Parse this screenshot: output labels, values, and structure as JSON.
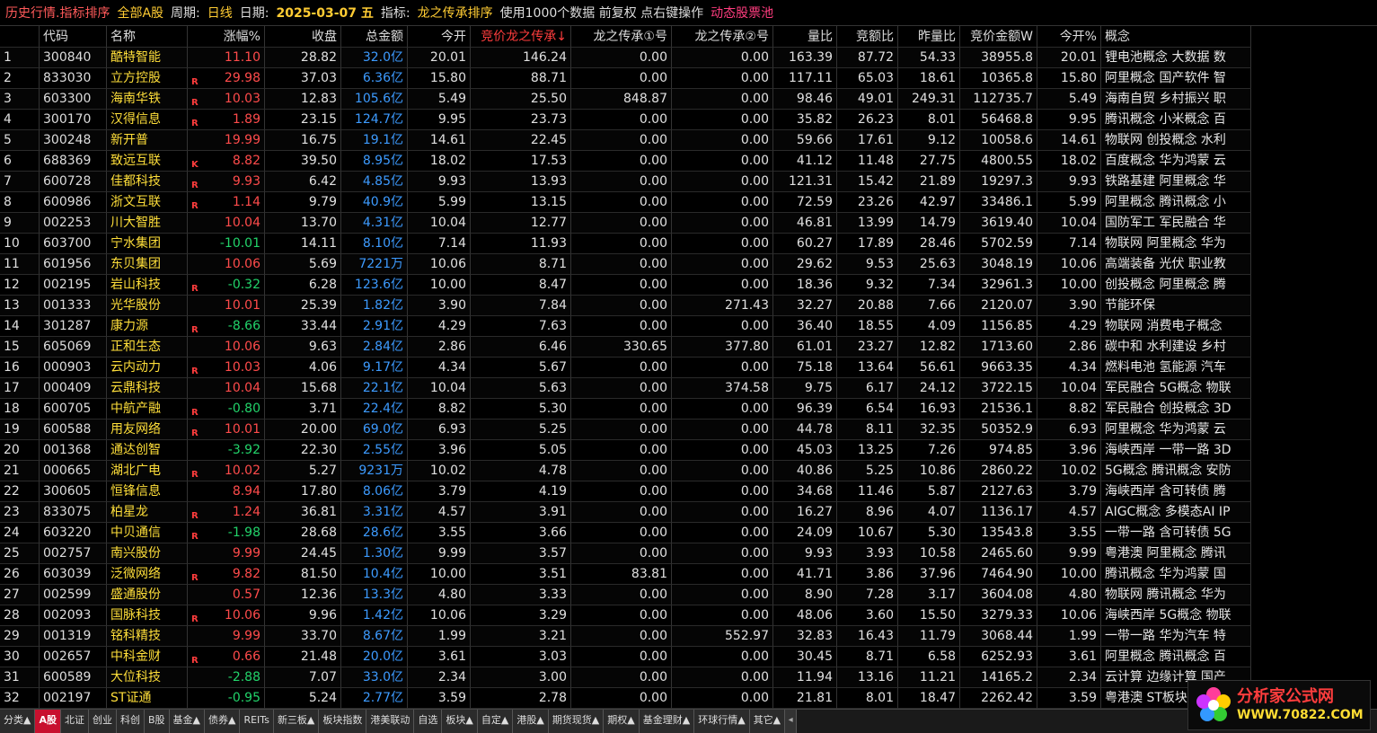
{
  "titlebar": {
    "part1": "历史行情.指标排序",
    "part2": "全部A股",
    "period_label": "周期:",
    "period_value": "日线",
    "date_label": "日期:",
    "date_value": "2025-03-07 五",
    "indicator_label": "指标:",
    "indicator_value": "龙之传承排序",
    "note": "使用1000个数据 前复权 点右键操作",
    "pool": "动态股票池"
  },
  "headers": [
    "",
    "代码",
    "名称",
    "涨幅%",
    "收盘",
    "总金额",
    "今开",
    "竞价龙之传承↓",
    "龙之传承①号",
    "龙之传承②号",
    "量比",
    "竞额比",
    "昨量比",
    "竞价金额W",
    "今开%",
    "概念"
  ],
  "rows": [
    {
      "no": "1",
      "code": "300840",
      "name": "酷特智能",
      "flag": "",
      "chg": "11.10",
      "dir": "up",
      "close": "28.82",
      "amt": "32.0亿",
      "open": "20.01",
      "jj": "146.24",
      "l1": "0.00",
      "l2": "0.00",
      "vr": "163.39",
      "jeb": "87.72",
      "zlb": "54.33",
      "jjje": "38955.8",
      "openpct": "20.01",
      "concept": "锂电池概念 大数据 数"
    },
    {
      "no": "2",
      "code": "833030",
      "name": "立方控股",
      "flag": "R",
      "chg": "29.98",
      "dir": "up",
      "close": "37.03",
      "amt": "6.36亿",
      "open": "15.80",
      "jj": "88.71",
      "l1": "0.00",
      "l2": "0.00",
      "vr": "117.11",
      "jeb": "65.03",
      "zlb": "18.61",
      "jjje": "10365.8",
      "openpct": "15.80",
      "concept": "阿里概念 国产软件 智"
    },
    {
      "no": "3",
      "code": "603300",
      "name": "海南华铁",
      "flag": "R",
      "chg": "10.03",
      "dir": "up",
      "close": "12.83",
      "amt": "105.6亿",
      "open": "5.49",
      "jj": "25.50",
      "l1": "848.87",
      "l2": "0.00",
      "vr": "98.46",
      "jeb": "49.01",
      "zlb": "249.31",
      "jjje": "112735.7",
      "openpct": "5.49",
      "concept": "海南自贸 乡村振兴 职"
    },
    {
      "no": "4",
      "code": "300170",
      "name": "汉得信息",
      "flag": "R",
      "chg": "1.89",
      "dir": "up",
      "close": "23.15",
      "amt": "124.7亿",
      "open": "9.95",
      "jj": "23.73",
      "l1": "0.00",
      "l2": "0.00",
      "vr": "35.82",
      "jeb": "26.23",
      "zlb": "8.01",
      "jjje": "56468.8",
      "openpct": "9.95",
      "concept": "腾讯概念 小米概念 百"
    },
    {
      "no": "5",
      "code": "300248",
      "name": "新开普",
      "flag": "",
      "chg": "19.99",
      "dir": "up",
      "close": "16.75",
      "amt": "19.1亿",
      "open": "14.61",
      "jj": "22.45",
      "l1": "0.00",
      "l2": "0.00",
      "vr": "59.66",
      "jeb": "17.61",
      "zlb": "9.12",
      "jjje": "10058.6",
      "openpct": "14.61",
      "concept": "物联网 创投概念 水利"
    },
    {
      "no": "6",
      "code": "688369",
      "name": "致远互联",
      "flag": "K",
      "chg": "8.82",
      "dir": "up",
      "close": "39.50",
      "amt": "8.95亿",
      "open": "18.02",
      "jj": "17.53",
      "l1": "0.00",
      "l2": "0.00",
      "vr": "41.12",
      "jeb": "11.48",
      "zlb": "27.75",
      "jjje": "4800.55",
      "openpct": "18.02",
      "concept": "百度概念 华为鸿蒙 云"
    },
    {
      "no": "7",
      "code": "600728",
      "name": "佳都科技",
      "flag": "R",
      "chg": "9.93",
      "dir": "up",
      "close": "6.42",
      "amt": "4.85亿",
      "open": "9.93",
      "jj": "13.93",
      "l1": "0.00",
      "l2": "0.00",
      "vr": "121.31",
      "jeb": "15.42",
      "zlb": "21.89",
      "jjje": "19297.3",
      "openpct": "9.93",
      "concept": "铁路基建 阿里概念 华"
    },
    {
      "no": "8",
      "code": "600986",
      "name": "浙文互联",
      "flag": "R",
      "chg": "1.14",
      "dir": "up",
      "close": "9.79",
      "amt": "40.9亿",
      "open": "5.99",
      "jj": "13.15",
      "l1": "0.00",
      "l2": "0.00",
      "vr": "72.59",
      "jeb": "23.26",
      "zlb": "42.97",
      "jjje": "33486.1",
      "openpct": "5.99",
      "concept": "阿里概念 腾讯概念 小"
    },
    {
      "no": "9",
      "code": "002253",
      "name": "川大智胜",
      "flag": "",
      "chg": "10.04",
      "dir": "up",
      "close": "13.70",
      "amt": "4.31亿",
      "open": "10.04",
      "jj": "12.77",
      "l1": "0.00",
      "l2": "0.00",
      "vr": "46.81",
      "jeb": "13.99",
      "zlb": "14.79",
      "jjje": "3619.40",
      "openpct": "10.04",
      "concept": "国防军工 军民融合 华"
    },
    {
      "no": "10",
      "code": "603700",
      "name": "宁水集团",
      "flag": "",
      "chg": "-10.01",
      "dir": "down",
      "close": "14.11",
      "amt": "8.10亿",
      "open": "7.14",
      "jj": "11.93",
      "l1": "0.00",
      "l2": "0.00",
      "vr": "60.27",
      "jeb": "17.89",
      "zlb": "28.46",
      "jjje": "5702.59",
      "openpct": "7.14",
      "concept": "物联网 阿里概念 华为"
    },
    {
      "no": "11",
      "code": "601956",
      "name": "东贝集团",
      "flag": "",
      "chg": "10.06",
      "dir": "up",
      "close": "5.69",
      "amt": "7221万",
      "open": "10.06",
      "jj": "8.71",
      "l1": "0.00",
      "l2": "0.00",
      "vr": "29.62",
      "jeb": "9.53",
      "zlb": "25.63",
      "jjje": "3048.19",
      "openpct": "10.06",
      "concept": "高端装备 光伏 职业教"
    },
    {
      "no": "12",
      "code": "002195",
      "name": "岩山科技",
      "flag": "R",
      "chg": "-0.32",
      "dir": "down",
      "close": "6.28",
      "amt": "123.6亿",
      "open": "10.00",
      "jj": "8.47",
      "l1": "0.00",
      "l2": "0.00",
      "vr": "18.36",
      "jeb": "9.32",
      "zlb": "7.34",
      "jjje": "32961.3",
      "openpct": "10.00",
      "concept": "创投概念 阿里概念 腾"
    },
    {
      "no": "13",
      "code": "001333",
      "name": "光华股份",
      "flag": "",
      "chg": "10.01",
      "dir": "up",
      "close": "25.39",
      "amt": "1.82亿",
      "open": "3.90",
      "jj": "7.84",
      "l1": "0.00",
      "l2": "271.43",
      "vr": "32.27",
      "jeb": "20.88",
      "zlb": "7.66",
      "jjje": "2120.07",
      "openpct": "3.90",
      "concept": "节能环保"
    },
    {
      "no": "14",
      "code": "301287",
      "name": "康力源",
      "flag": "R",
      "chg": "-8.66",
      "dir": "down",
      "close": "33.44",
      "amt": "2.91亿",
      "open": "4.29",
      "jj": "7.63",
      "l1": "0.00",
      "l2": "0.00",
      "vr": "36.40",
      "jeb": "18.55",
      "zlb": "4.09",
      "jjje": "1156.85",
      "openpct": "4.29",
      "concept": "物联网 消费电子概念"
    },
    {
      "no": "15",
      "code": "605069",
      "name": "正和生态",
      "flag": "",
      "chg": "10.06",
      "dir": "up",
      "close": "9.63",
      "amt": "2.84亿",
      "open": "2.86",
      "jj": "6.46",
      "l1": "330.65",
      "l2": "377.80",
      "vr": "61.01",
      "jeb": "23.27",
      "zlb": "12.82",
      "jjje": "1713.60",
      "openpct": "2.86",
      "concept": "碳中和 水利建设 乡村"
    },
    {
      "no": "16",
      "code": "000903",
      "name": "云内动力",
      "flag": "R",
      "chg": "10.03",
      "dir": "up",
      "close": "4.06",
      "amt": "9.17亿",
      "open": "4.34",
      "jj": "5.67",
      "l1": "0.00",
      "l2": "0.00",
      "vr": "75.18",
      "jeb": "13.64",
      "zlb": "56.61",
      "jjje": "9663.35",
      "openpct": "4.34",
      "concept": "燃料电池 氢能源 汽车"
    },
    {
      "no": "17",
      "code": "000409",
      "name": "云鼎科技",
      "flag": "",
      "chg": "10.04",
      "dir": "up",
      "close": "15.68",
      "amt": "22.1亿",
      "open": "10.04",
      "jj": "5.63",
      "l1": "0.00",
      "l2": "374.58",
      "vr": "9.75",
      "jeb": "6.17",
      "zlb": "24.12",
      "jjje": "3722.15",
      "openpct": "10.04",
      "concept": "军民融合 5G概念 物联"
    },
    {
      "no": "18",
      "code": "600705",
      "name": "中航产融",
      "flag": "R",
      "chg": "-0.80",
      "dir": "down",
      "close": "3.71",
      "amt": "22.4亿",
      "open": "8.82",
      "jj": "5.30",
      "l1": "0.00",
      "l2": "0.00",
      "vr": "96.39",
      "jeb": "6.54",
      "zlb": "16.93",
      "jjje": "21536.1",
      "openpct": "8.82",
      "concept": "军民融合 创投概念 3D"
    },
    {
      "no": "19",
      "code": "600588",
      "name": "用友网络",
      "flag": "R",
      "chg": "10.01",
      "dir": "up",
      "close": "20.00",
      "amt": "69.0亿",
      "open": "6.93",
      "jj": "5.25",
      "l1": "0.00",
      "l2": "0.00",
      "vr": "44.78",
      "jeb": "8.11",
      "zlb": "32.35",
      "jjje": "50352.9",
      "openpct": "6.93",
      "concept": "阿里概念 华为鸿蒙 云"
    },
    {
      "no": "20",
      "code": "001368",
      "name": "通达创智",
      "flag": "",
      "chg": "-3.92",
      "dir": "down",
      "close": "22.30",
      "amt": "2.55亿",
      "open": "3.96",
      "jj": "5.05",
      "l1": "0.00",
      "l2": "0.00",
      "vr": "45.03",
      "jeb": "13.25",
      "zlb": "7.26",
      "jjje": "974.85",
      "openpct": "3.96",
      "concept": "海峡西岸 一带一路 3D"
    },
    {
      "no": "21",
      "code": "000665",
      "name": "湖北广电",
      "flag": "R",
      "chg": "10.02",
      "dir": "up",
      "close": "5.27",
      "amt": "9231万",
      "open": "10.02",
      "jj": "4.78",
      "l1": "0.00",
      "l2": "0.00",
      "vr": "40.86",
      "jeb": "5.25",
      "zlb": "10.86",
      "jjje": "2860.22",
      "openpct": "10.02",
      "concept": "5G概念 腾讯概念 安防"
    },
    {
      "no": "22",
      "code": "300605",
      "name": "恒锋信息",
      "flag": "",
      "chg": "8.94",
      "dir": "up",
      "close": "17.80",
      "amt": "8.06亿",
      "open": "3.79",
      "jj": "4.19",
      "l1": "0.00",
      "l2": "0.00",
      "vr": "34.68",
      "jeb": "11.46",
      "zlb": "5.87",
      "jjje": "2127.63",
      "openpct": "3.79",
      "concept": "海峡西岸 含可转债 腾"
    },
    {
      "no": "23",
      "code": "833075",
      "name": "柏星龙",
      "flag": "R",
      "chg": "1.24",
      "dir": "up",
      "close": "36.81",
      "amt": "3.31亿",
      "open": "4.57",
      "jj": "3.91",
      "l1": "0.00",
      "l2": "0.00",
      "vr": "16.27",
      "jeb": "8.96",
      "zlb": "4.07",
      "jjje": "1136.17",
      "openpct": "4.57",
      "concept": "AIGC概念 多模态AI IP"
    },
    {
      "no": "24",
      "code": "603220",
      "name": "中贝通信",
      "flag": "R",
      "chg": "-1.98",
      "dir": "down",
      "close": "28.68",
      "amt": "28.6亿",
      "open": "3.55",
      "jj": "3.66",
      "l1": "0.00",
      "l2": "0.00",
      "vr": "24.09",
      "jeb": "10.67",
      "zlb": "5.30",
      "jjje": "13543.8",
      "openpct": "3.55",
      "concept": "一带一路 含可转债 5G"
    },
    {
      "no": "25",
      "code": "002757",
      "name": "南兴股份",
      "flag": "",
      "chg": "9.99",
      "dir": "up",
      "close": "24.45",
      "amt": "1.30亿",
      "open": "9.99",
      "jj": "3.57",
      "l1": "0.00",
      "l2": "0.00",
      "vr": "9.93",
      "jeb": "3.93",
      "zlb": "10.58",
      "jjje": "2465.60",
      "openpct": "9.99",
      "concept": "粤港澳 阿里概念 腾讯"
    },
    {
      "no": "26",
      "code": "603039",
      "name": "泛微网络",
      "flag": "R",
      "chg": "9.82",
      "dir": "up",
      "close": "81.50",
      "amt": "10.4亿",
      "open": "10.00",
      "jj": "3.51",
      "l1": "83.81",
      "l2": "0.00",
      "vr": "41.71",
      "jeb": "3.86",
      "zlb": "37.96",
      "jjje": "7464.90",
      "openpct": "10.00",
      "concept": "腾讯概念 华为鸿蒙 国"
    },
    {
      "no": "27",
      "code": "002599",
      "name": "盛通股份",
      "flag": "",
      "chg": "0.57",
      "dir": "up",
      "close": "12.36",
      "amt": "13.3亿",
      "open": "4.80",
      "jj": "3.33",
      "l1": "0.00",
      "l2": "0.00",
      "vr": "8.90",
      "jeb": "7.28",
      "zlb": "3.17",
      "jjje": "3604.08",
      "openpct": "4.80",
      "concept": "物联网 腾讯概念 华为"
    },
    {
      "no": "28",
      "code": "002093",
      "name": "国脉科技",
      "flag": "R",
      "chg": "10.06",
      "dir": "up",
      "close": "9.96",
      "amt": "1.42亿",
      "open": "10.06",
      "jj": "3.29",
      "l1": "0.00",
      "l2": "0.00",
      "vr": "48.06",
      "jeb": "3.60",
      "zlb": "15.50",
      "jjje": "3279.33",
      "openpct": "10.06",
      "concept": "海峡西岸 5G概念 物联"
    },
    {
      "no": "29",
      "code": "001319",
      "name": "铭科精技",
      "flag": "",
      "chg": "9.99",
      "dir": "up",
      "close": "33.70",
      "amt": "8.67亿",
      "open": "1.99",
      "jj": "3.21",
      "l1": "0.00",
      "l2": "552.97",
      "vr": "32.83",
      "jeb": "16.43",
      "zlb": "11.79",
      "jjje": "3068.44",
      "openpct": "1.99",
      "concept": "一带一路 华为汽车 特"
    },
    {
      "no": "30",
      "code": "002657",
      "name": "中科金财",
      "flag": "R",
      "chg": "0.66",
      "dir": "up",
      "close": "21.48",
      "amt": "20.0亿",
      "open": "3.61",
      "jj": "3.03",
      "l1": "0.00",
      "l2": "0.00",
      "vr": "30.45",
      "jeb": "8.71",
      "zlb": "6.58",
      "jjje": "6252.93",
      "openpct": "3.61",
      "concept": "阿里概念 腾讯概念 百"
    },
    {
      "no": "31",
      "code": "600589",
      "name": "大位科技",
      "flag": "",
      "chg": "-2.88",
      "dir": "down",
      "close": "7.07",
      "amt": "33.0亿",
      "open": "2.34",
      "jj": "3.00",
      "l1": "0.00",
      "l2": "0.00",
      "vr": "11.94",
      "jeb": "13.16",
      "zlb": "11.21",
      "jjje": "14165.2",
      "openpct": "2.34",
      "concept": "云计算 边缘计算 国产"
    },
    {
      "no": "32",
      "code": "002197",
      "name": "ST证通",
      "flag": "",
      "chg": "-0.95",
      "dir": "down",
      "close": "5.24",
      "amt": "2.77亿",
      "open": "3.59",
      "jj": "2.78",
      "l1": "0.00",
      "l2": "0.00",
      "vr": "21.81",
      "jeb": "8.01",
      "zlb": "18.47",
      "jjje": "2262.42",
      "openpct": "3.59",
      "concept": "粤港澳 ST板块"
    }
  ],
  "bottom_tabs": [
    "分类▲",
    "A股",
    "北证",
    "创业",
    "科创",
    "B股",
    "基金▲",
    "债券▲",
    "REITs",
    "新三板▲",
    "板块指数",
    "港美联动",
    "自选",
    "板块▲",
    "自定▲",
    "港股▲",
    "期货现货▲",
    "期权▲",
    "基金理财▲",
    "环球行情▲",
    "其它▲"
  ],
  "bottom_active": "A股",
  "watermark": {
    "line1": "分析家公式网",
    "line2": "WWW.70822.COM"
  },
  "colors": {
    "up": "#ff4b4b",
    "down": "#22d36a",
    "amount": "#3d9bff",
    "name": "#ffdf3a",
    "active_tab": "#c8102e"
  }
}
